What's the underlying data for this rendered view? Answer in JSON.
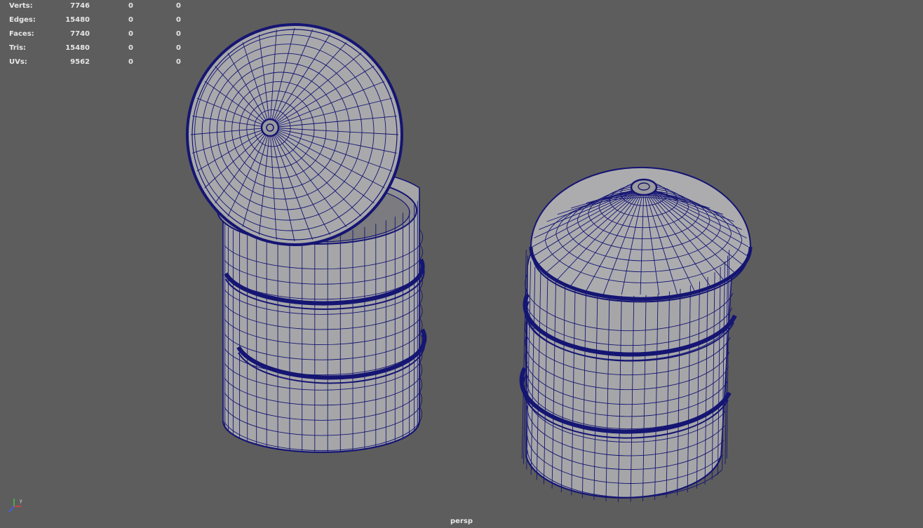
{
  "stats": [
    {
      "label": "Verts:",
      "total": "7746",
      "selected": "0",
      "component": "0"
    },
    {
      "label": "Edges:",
      "total": "15480",
      "selected": "0",
      "component": "0"
    },
    {
      "label": "Faces:",
      "total": "7740",
      "selected": "0",
      "component": "0"
    },
    {
      "label": "Tris:",
      "total": "15480",
      "selected": "0",
      "component": "0"
    },
    {
      "label": "UVs:",
      "total": "9562",
      "selected": "0",
      "component": "0"
    }
  ],
  "camera": "persp",
  "colors": {
    "background": "#5d5d5d",
    "mesh_fill": "#a6a6a8",
    "wireframe": "#151573",
    "hud_text": "#e6e6e6"
  },
  "scene_objects": [
    "open-barrel-with-lid",
    "closed-barrel"
  ],
  "gizmo_icon": "xyz-axis-icon"
}
